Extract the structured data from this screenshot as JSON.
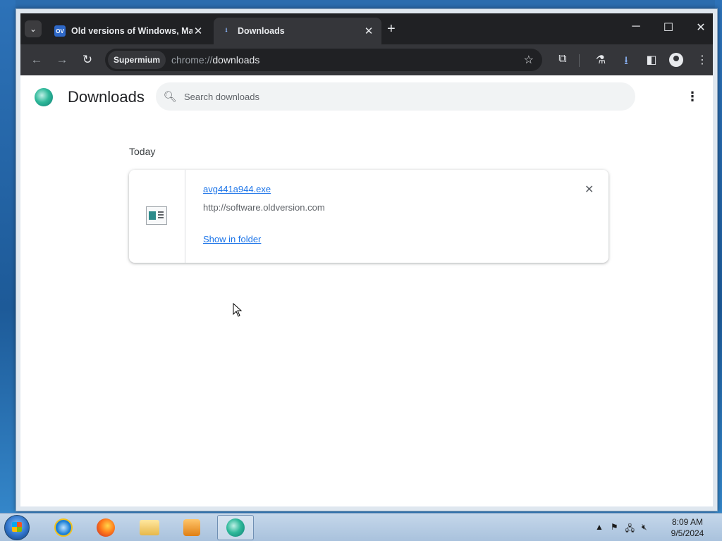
{
  "browser": {
    "tabs": [
      {
        "title": "Old versions of Windows, Mac",
        "favicon": "OV",
        "active": false
      },
      {
        "title": "Downloads",
        "favicon": "download-icon",
        "active": true
      }
    ],
    "omnibox": {
      "chip_label": "Supermium",
      "url_scheme": "chrome://",
      "url_path": "downloads"
    }
  },
  "downloads_page": {
    "title": "Downloads",
    "search_placeholder": "Search downloads",
    "section_label": "Today",
    "items": [
      {
        "file_name": "avg441a944.exe",
        "source_url": "http://software.oldversion.com",
        "action_label": "Show in folder"
      }
    ]
  },
  "taskbar": {
    "apps": [
      "internet-explorer",
      "firefox",
      "file-explorer",
      "media-player",
      "supermium"
    ],
    "clock_time": "8:09 AM",
    "clock_date": "9/5/2024"
  },
  "colors": {
    "link": "#1a73e8",
    "titlebar": "#202124",
    "toolbar": "#35363a"
  }
}
